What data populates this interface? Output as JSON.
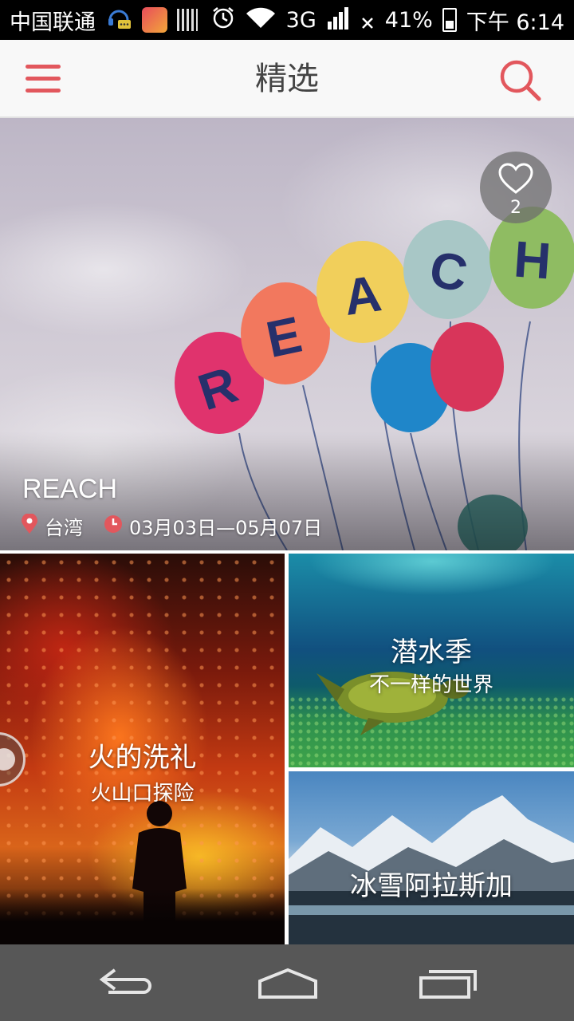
{
  "status_bar": {
    "carrier": "中国联通",
    "network": "3G",
    "battery": "41%",
    "time": "下午 6:14"
  },
  "app_bar": {
    "title": "精选"
  },
  "hero": {
    "title": "REACH",
    "location": "台湾",
    "date_range": "03月03日—05月07日",
    "like_count": "2"
  },
  "tiles": [
    {
      "title": "火的洗礼",
      "subtitle": "火山口探险"
    },
    {
      "title": "潜水季",
      "subtitle": "不一样的世界"
    },
    {
      "title": "冰雪阿拉斯加"
    }
  ],
  "colors": {
    "accent": "#e2575d",
    "nav_bar": "#575757"
  },
  "icons": {
    "menu": "hamburger-icon",
    "search": "search-icon",
    "like": "heart-icon",
    "location": "pin-icon",
    "time": "clock-icon"
  }
}
